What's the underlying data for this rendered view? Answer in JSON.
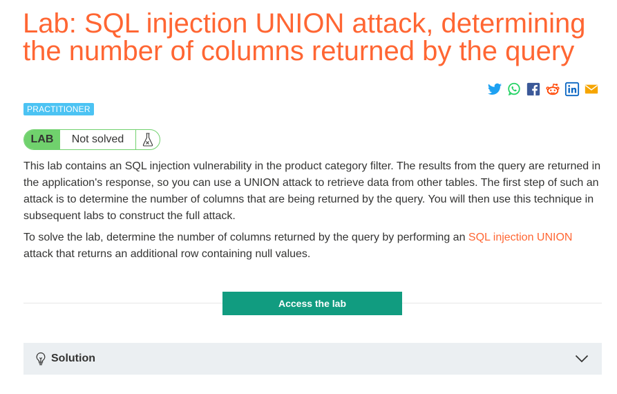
{
  "page": {
    "title": "Lab: SQL injection UNION attack, determining the number of columns returned by the query"
  },
  "share_icons": [
    "twitter-icon",
    "whatsapp-icon",
    "facebook-icon",
    "reddit-icon",
    "linkedin-icon",
    "email-icon"
  ],
  "badge": {
    "level": "PRACTITIONER"
  },
  "status": {
    "lab_label": "LAB",
    "state": "Not solved",
    "icon": "flask-icon"
  },
  "description": {
    "p1": "This lab contains an SQL injection vulnerability in the product category filter. The results from the query are returned in the application's response, so you can use a UNION attack to retrieve data from other tables. The first step of such an attack is to determine the number of columns that are being returned by the query. You will then use this technique in subsequent labs to construct the full attack.",
    "p2_before": "To solve the lab, determine the number of columns returned by the query by performing an ",
    "p2_link": "SQL injection UNION",
    "p2_after": " attack that returns an additional row containing null values."
  },
  "actions": {
    "access_label": "Access the lab"
  },
  "solution": {
    "label": "Solution"
  },
  "colors": {
    "accent": "#ff6633",
    "badge": "#4cc3f3",
    "status_green": "#70d16d",
    "button": "#119c80"
  }
}
